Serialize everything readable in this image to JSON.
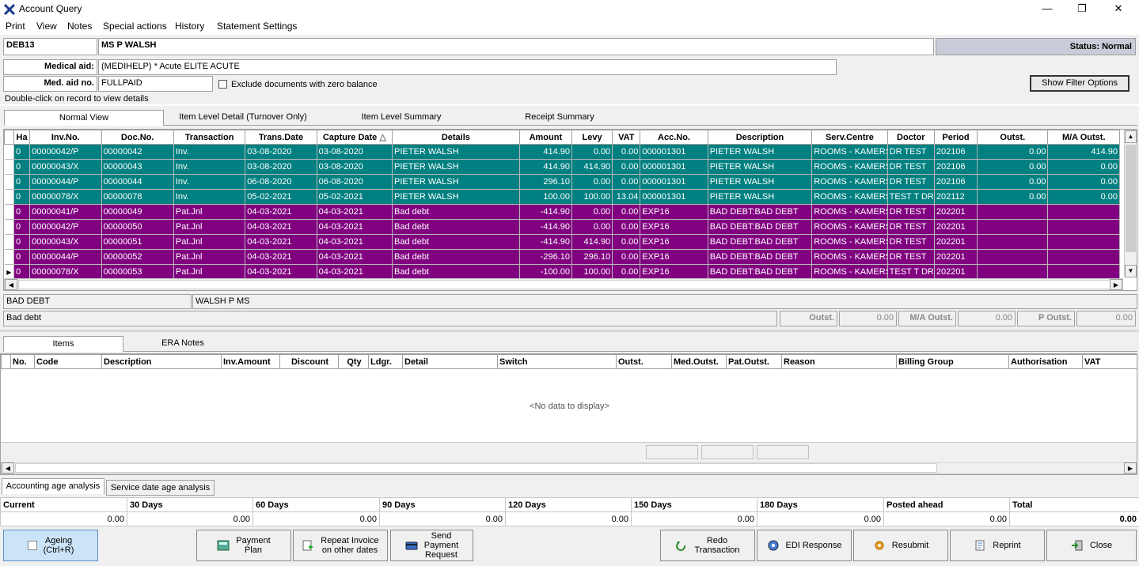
{
  "window": {
    "title": "Account Query",
    "minimize": "—",
    "restore": "❐",
    "close": "✕"
  },
  "menu": [
    "Print",
    "View",
    "Notes",
    "Special actions",
    "History",
    "Statement Settings"
  ],
  "account": {
    "code": "DEB13",
    "name": "MS P WALSH",
    "status": "Status: Normal",
    "medical_aid_label": "Medical aid:",
    "medical_aid": "(MEDIHELP) * Acute ELITE ACUTE",
    "med_aid_no_label": "Med. aid no.",
    "med_aid_no": "FULLPAID",
    "exclude_label": "Exclude documents with zero balance",
    "show_filter": "Show Filter Options",
    "hint": "Double-click on record to view details"
  },
  "tabs": [
    "Normal View",
    "Item Level Detail (Turnover Only)",
    "Item Level Summary",
    "Receipt Summary"
  ],
  "grid": {
    "columns": [
      "Ha",
      "Inv.No.",
      "Doc.No.",
      "Transaction",
      "Trans.Date",
      "Capture Date",
      "Details",
      "Amount",
      "Levy",
      "VAT",
      "Acc.No.",
      "Description",
      "Serv.Centre",
      "Doctor",
      "Period",
      "Outst.",
      "M/A Outst."
    ],
    "sort_icon": "△",
    "rows": [
      {
        "style": "teal",
        "cells": [
          "0",
          "00000042/P",
          "00000042",
          "Inv.",
          "03-08-2020",
          "03-08-2020",
          "PIETER WALSH",
          "414.90",
          "0.00",
          "0.00",
          "000001301",
          "PIETER WALSH",
          "ROOMS - KAMERS",
          "DR TEST",
          "202106",
          "0.00",
          "414.90"
        ]
      },
      {
        "style": "teal",
        "cells": [
          "0",
          "00000043/X",
          "00000043",
          "Inv.",
          "03-08-2020",
          "03-08-2020",
          "PIETER WALSH",
          "414.90",
          "414.90",
          "0.00",
          "000001301",
          "PIETER WALSH",
          "ROOMS - KAMERS",
          "DR TEST",
          "202106",
          "0.00",
          "0.00"
        ]
      },
      {
        "style": "teal",
        "cells": [
          "0",
          "00000044/P",
          "00000044",
          "Inv.",
          "06-08-2020",
          "06-08-2020",
          "PIETER WALSH",
          "296.10",
          "0.00",
          "0.00",
          "000001301",
          "PIETER WALSH",
          "ROOMS - KAMERS",
          "DR TEST",
          "202106",
          "0.00",
          "0.00"
        ]
      },
      {
        "style": "teal",
        "cells": [
          "0",
          "00000078/X",
          "00000078",
          "Inv.",
          "05-02-2021",
          "05-02-2021",
          "PIETER WALSH",
          "100.00",
          "100.00",
          "13.04",
          "000001301",
          "PIETER WALSH",
          "ROOMS - KAMERS",
          "TEST T DR",
          "202112",
          "0.00",
          "0.00"
        ]
      },
      {
        "style": "purple",
        "cells": [
          "0",
          "00000041/P",
          "00000049",
          "Pat.Jnl",
          "04-03-2021",
          "04-03-2021",
          "Bad debt",
          "-414.90",
          "0.00",
          "0.00",
          "EXP16",
          "BAD DEBT:BAD DEBT",
          "ROOMS - KAMERS",
          "DR TEST",
          "202201",
          "",
          ""
        ]
      },
      {
        "style": "purple",
        "cells": [
          "0",
          "00000042/P",
          "00000050",
          "Pat.Jnl",
          "04-03-2021",
          "04-03-2021",
          "Bad debt",
          "-414.90",
          "0.00",
          "0.00",
          "EXP16",
          "BAD DEBT:BAD DEBT",
          "ROOMS - KAMERS",
          "DR TEST",
          "202201",
          "",
          ""
        ]
      },
      {
        "style": "purple",
        "cells": [
          "0",
          "00000043/X",
          "00000051",
          "Pat.Jnl",
          "04-03-2021",
          "04-03-2021",
          "Bad debt",
          "-414.90",
          "414.90",
          "0.00",
          "EXP16",
          "BAD DEBT:BAD DEBT",
          "ROOMS - KAMERS",
          "DR TEST",
          "202201",
          "",
          ""
        ]
      },
      {
        "style": "purple",
        "cells": [
          "0",
          "00000044/P",
          "00000052",
          "Pat.Jnl",
          "04-03-2021",
          "04-03-2021",
          "Bad debt",
          "-296.10",
          "296.10",
          "0.00",
          "EXP16",
          "BAD DEBT:BAD DEBT",
          "ROOMS - KAMERS",
          "DR TEST",
          "202201",
          "",
          ""
        ]
      },
      {
        "style": "purple",
        "cells": [
          "0",
          "00000078/X",
          "00000053",
          "Pat.Jnl",
          "04-03-2021",
          "04-03-2021",
          "Bad debt",
          "-100.00",
          "100.00",
          "0.00",
          "EXP16",
          "BAD DEBT:BAD DEBT",
          "ROOMS - KAMERS",
          "TEST T DR",
          "202201",
          "",
          ""
        ]
      }
    ]
  },
  "detail": {
    "desc1": "BAD DEBT",
    "desc2": "WALSH P MS",
    "desc3": "Bad debt",
    "outst_label": "Outst.",
    "outst": "0.00",
    "ma_outst_label": "M/A Outst.",
    "ma_outst": "0.00",
    "p_outst_label": "P Outst.",
    "p_outst": "0.00"
  },
  "lower_tabs": [
    "Items",
    "ERA Notes"
  ],
  "items_grid": {
    "columns": [
      "No.",
      "Code",
      "Description",
      "Inv.Amount",
      "Discount",
      "Qty",
      "Ldgr.",
      "Detail",
      "Switch",
      "Outst.",
      "Med.Outst.",
      "Pat.Outst.",
      "Reason",
      "Billing Group",
      "Authorisation",
      "VAT"
    ],
    "empty": "<No data to display>"
  },
  "age_tabs": [
    "Accounting age analysis",
    "Service date age analysis"
  ],
  "age": {
    "headers": [
      "Current",
      "30 Days",
      "60 Days",
      "90 Days",
      "120 Days",
      "150 Days",
      "180 Days",
      "Posted ahead",
      "Total"
    ],
    "values": [
      "0.00",
      "0.00",
      "0.00",
      "0.00",
      "0.00",
      "0.00",
      "0.00",
      "0.00",
      "0.00"
    ]
  },
  "buttons": {
    "ageing": "Ageing\n(Ctrl+R)",
    "payment_plan": "Payment\nPlan",
    "repeat_invoice": "Repeat Invoice\non other dates",
    "send_payment": "Send\nPayment\nRequest",
    "redo": "Redo\nTransaction",
    "edi": "EDI Response",
    "resubmit": "Resubmit",
    "reprint": "Reprint",
    "close": "Close"
  },
  "colors": {
    "teal": "#008080",
    "purple": "#800080",
    "status_bg": "#c8cbd8"
  }
}
